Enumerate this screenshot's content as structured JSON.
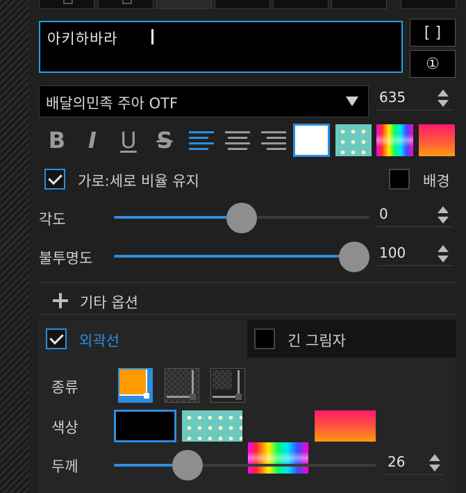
{
  "text_input": {
    "value": "아키하바라"
  },
  "side_buttons": {
    "brackets_label": "[ ]",
    "circled_one_label": "①"
  },
  "font": {
    "selected": "배달의민족 주아 OTF",
    "size": "635"
  },
  "format": {
    "bold": "B",
    "italic": "I",
    "underline": "U",
    "strike": "S"
  },
  "aspect": {
    "label": "가로:세로 비율 유지",
    "checked": true
  },
  "background": {
    "label": "배경",
    "checked": false
  },
  "angle": {
    "label": "각도",
    "value": "0",
    "fraction": 0.5
  },
  "opacity": {
    "label": "불투명도",
    "value": "100",
    "fraction": 1.0
  },
  "more_options": {
    "label": "기타 옵션",
    "icon": "plus-icon"
  },
  "tabs": {
    "outline": {
      "label": "외곽선",
      "checked": true
    },
    "long_shadow": {
      "label": "긴 그림자",
      "checked": false
    }
  },
  "outline": {
    "type_label": "종류",
    "color_label": "색상",
    "thickness_label": "두께",
    "thickness_value": "26",
    "thickness_fraction": 0.28
  },
  "colors": {
    "accent": "#2c8de0",
    "input_border": "#1ea4e4",
    "orange": "#ff9a00"
  }
}
